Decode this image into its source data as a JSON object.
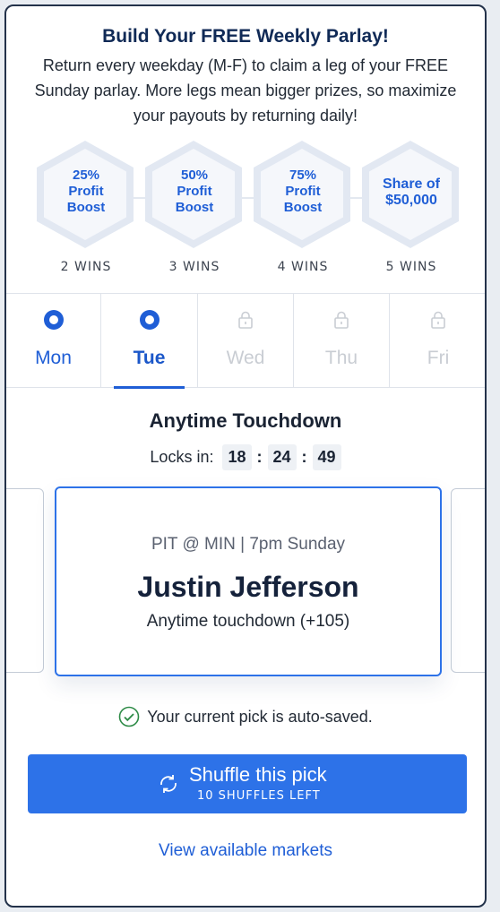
{
  "header": {
    "title": "Build Your FREE Weekly Parlay!",
    "description": "Return every weekday (M-F) to claim a leg of your FREE Sunday parlay. More legs mean bigger prizes, so maximize your payouts by returning daily!"
  },
  "tiers": [
    {
      "line1": "25%",
      "line2": "Profit",
      "line3": "Boost",
      "wins": "2 WINS"
    },
    {
      "line1": "50%",
      "line2": "Profit",
      "line3": "Boost",
      "wins": "3 WINS"
    },
    {
      "line1": "75%",
      "line2": "Profit",
      "line3": "Boost",
      "wins": "4 WINS"
    },
    {
      "line1": "Share of",
      "line2": "$50,000",
      "wins": "5 WINS"
    }
  ],
  "days": [
    {
      "label": "Mon",
      "state": "completed",
      "icon": "radio-check-icon"
    },
    {
      "label": "Tue",
      "state": "active",
      "icon": "radio-check-icon"
    },
    {
      "label": "Wed",
      "state": "locked",
      "icon": "lock-icon"
    },
    {
      "label": "Thu",
      "state": "locked",
      "icon": "lock-icon"
    },
    {
      "label": "Fri",
      "state": "locked",
      "icon": "lock-icon"
    }
  ],
  "market": {
    "title": "Anytime Touchdown",
    "locks_label": "Locks in:",
    "timer": {
      "hours": "18",
      "minutes": "24",
      "seconds": "49"
    }
  },
  "pick": {
    "matchup": "PIT @ MIN | 7pm Sunday",
    "player": "Justin Jefferson",
    "market": "Anytime touchdown (+105)"
  },
  "autosave_text": "Your current pick is auto-saved.",
  "shuffle": {
    "title": "Shuffle this pick",
    "subtitle": "10 SHUFFLES LEFT"
  },
  "view_markets": "View available markets",
  "colors": {
    "accent": "#2d72e8",
    "heading": "#102a56",
    "locked": "#c9cdd3"
  }
}
